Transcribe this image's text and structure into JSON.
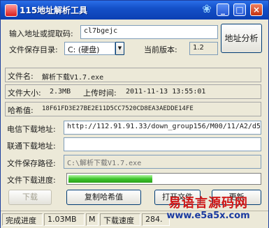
{
  "window": {
    "title": "115地址解析工具",
    "skin_icon": "shirt-icon",
    "min_label": "_",
    "max_label": "□",
    "close_label": "×"
  },
  "input": {
    "label": "输入地址或提取码:",
    "value": "cl7bgejc",
    "analyze_button": "地址分析"
  },
  "save_dir": {
    "label": "文件保存目录:",
    "selected": "C: (硬盘)",
    "dropdown_arrow": "▼"
  },
  "version": {
    "label": "当前版本:",
    "value": "1.2"
  },
  "file": {
    "name_label": "文件名:",
    "name": "解析下载V1.7.exe",
    "size_label": "文件大小:",
    "size": "2.3MB",
    "upload_label": "上传时间:",
    "upload_time": "2011-11-13 13:55:01",
    "hash_label": "哈希值:",
    "hash": "18F61FD3E27BE2E11D5CC7520CD8EA3AEDDE14FE"
  },
  "telecom": {
    "label": "电信下载地址:",
    "value": "http://112.91.91.33/down_group156/M00/11/A2/d5"
  },
  "unicom": {
    "label": "联通下载地址:",
    "value": ""
  },
  "save_path": {
    "label": "文件保存路径:",
    "value": "C:\\解析下载V1.7.exe"
  },
  "progress": {
    "label": "文件下载进度:",
    "fraction": 0.44
  },
  "buttons": {
    "download": "下载",
    "copy_hash": "复制哈希值",
    "open_folder": "打开文件",
    "update": "更新"
  },
  "status": {
    "progress_label": "完成进度",
    "downloaded": "1.03MB",
    "unit": "M",
    "speed_label": "下载速度",
    "speed": "284."
  },
  "watermark": {
    "site_name": "易语言源码网",
    "url": "www.e5a5x.com"
  }
}
